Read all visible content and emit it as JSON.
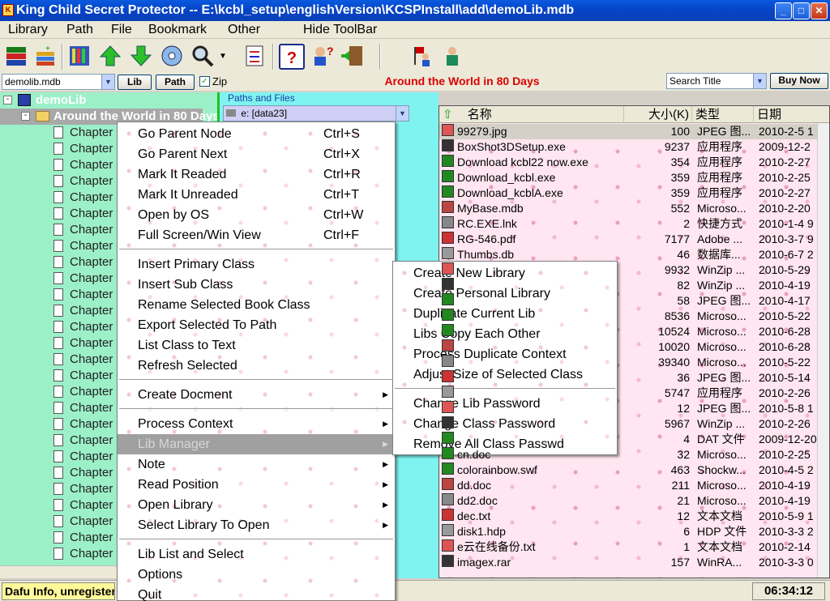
{
  "window": {
    "title": "King Child Secret Protector -- E:\\kcbl_setup\\englishVersion\\KCSPInstall\\add\\demoLib.mdb",
    "icon": "app-icon",
    "buttons": [
      "minimize",
      "maximize",
      "close"
    ]
  },
  "menubar": {
    "items": [
      "Library",
      "Path",
      "File",
      "Bookmark",
      "Other",
      "Hide ToolBar"
    ]
  },
  "toolbar": {
    "icons": [
      "library-books-icon",
      "add-book-icon",
      "bookcase-icon",
      "arrow-up-icon",
      "arrow-down-icon",
      "disc-icon",
      "search-icon",
      "dropdown-arrow-icon",
      "checklist-icon",
      "help-icon",
      "question-person-icon",
      "exit-door-icon",
      "flag-person-icon",
      "person-icon"
    ]
  },
  "addressbar": {
    "library_combo": "demolib.mdb",
    "lib_button": "Lib",
    "path_button": "Path",
    "zip_label": "Zip",
    "zip_checked": true,
    "book_title": "Around the World in 80 Days",
    "search_combo": "Search Title",
    "buy_button": "Buy Now"
  },
  "tree": {
    "root": "demoLib",
    "book": "Around the World in 80 Days",
    "chapter_label": "Chapter",
    "chapter_count": 27
  },
  "paths": {
    "label": "Paths and Files",
    "drive": "e: [data23]"
  },
  "files": {
    "columns": [
      "名称",
      "大小(K)",
      "类型",
      "日期"
    ],
    "rows": [
      {
        "name": "99279.jpg",
        "size": "100",
        "type": "JPEG 图...",
        "date": "2010-2-5 1"
      },
      {
        "name": "BoxShot3DSetup.exe",
        "size": "9237",
        "type": "应用程序",
        "date": "2009-12-2"
      },
      {
        "name": "Download kcbl22 now.exe",
        "size": "354",
        "type": "应用程序",
        "date": "2010-2-27"
      },
      {
        "name": "Download_kcbl.exe",
        "size": "359",
        "type": "应用程序",
        "date": "2010-2-25"
      },
      {
        "name": "Download_kcblA.exe",
        "size": "359",
        "type": "应用程序",
        "date": "2010-2-27"
      },
      {
        "name": "MyBase.mdb",
        "size": "552",
        "type": "Microso...",
        "date": "2010-2-20"
      },
      {
        "name": "RC.EXE.lnk",
        "size": "2",
        "type": "快捷方式",
        "date": "2010-1-4 9"
      },
      {
        "name": "RG-546.pdf",
        "size": "7177",
        "type": "Adobe ...",
        "date": "2010-3-7 9"
      },
      {
        "name": "Thumbs.db",
        "size": "46",
        "type": "数据库...",
        "date": "2010-6-7 2"
      },
      {
        "name": "",
        "size": "9932",
        "type": "WinZip ...",
        "date": "2010-5-29"
      },
      {
        "name": "",
        "size": "82",
        "type": "WinZip ...",
        "date": "2010-4-19"
      },
      {
        "name": "",
        "size": "58",
        "type": "JPEG 图...",
        "date": "2010-4-17"
      },
      {
        "name": "",
        "size": "8536",
        "type": "Microso...",
        "date": "2010-5-22"
      },
      {
        "name": "",
        "size": "10524",
        "type": "Microso...",
        "date": "2010-6-28"
      },
      {
        "name": "",
        "size": "10020",
        "type": "Microso...",
        "date": "2010-6-28"
      },
      {
        "name": "",
        "size": "39340",
        "type": "Microso...",
        "date": "2010-5-22"
      },
      {
        "name": "",
        "size": "36",
        "type": "JPEG 图...",
        "date": "2010-5-14"
      },
      {
        "name": "",
        "size": "5747",
        "type": "应用程序",
        "date": "2010-2-26"
      },
      {
        "name": "",
        "size": "12",
        "type": "JPEG 图...",
        "date": "2010-5-8 1"
      },
      {
        "name": "",
        "size": "5967",
        "type": "WinZip ...",
        "date": "2010-2-26"
      },
      {
        "name": "",
        "size": "4",
        "type": "DAT 文件",
        "date": "2009-12-20"
      },
      {
        "name": "cn.doc",
        "size": "32",
        "type": "Microso...",
        "date": "2010-2-25"
      },
      {
        "name": "colorainbow.swf",
        "size": "463",
        "type": "Shockw...",
        "date": "2010-4-5 2"
      },
      {
        "name": "dd.doc",
        "size": "211",
        "type": "Microso...",
        "date": "2010-4-19"
      },
      {
        "name": "dd2.doc",
        "size": "21",
        "type": "Microso...",
        "date": "2010-4-19"
      },
      {
        "name": "dec.txt",
        "size": "12",
        "type": "文本文档",
        "date": "2010-5-9 1"
      },
      {
        "name": "disk1.hdp",
        "size": "6",
        "type": "HDP 文件",
        "date": "2010-3-3 2"
      },
      {
        "name": "e云在线备份.txt",
        "size": "1",
        "type": "文本文档",
        "date": "2010-2-14"
      },
      {
        "name": "imagex.rar",
        "size": "157",
        "type": "WinRA...",
        "date": "2010-3-3 0"
      }
    ]
  },
  "context_menu": {
    "items": [
      {
        "label": "Go Parent Node",
        "shortcut": "Ctrl+S"
      },
      {
        "label": "Go Parent Next",
        "shortcut": "Ctrl+X"
      },
      {
        "label": "Mark It Readed",
        "shortcut": "Ctrl+R"
      },
      {
        "label": "Mark It Unreaded",
        "shortcut": "Ctrl+T"
      },
      {
        "label": "Open by OS",
        "shortcut": "Ctrl+W"
      },
      {
        "label": "Full Screen/Win View",
        "shortcut": "Ctrl+F"
      },
      {
        "sep": true
      },
      {
        "label": "Insert Primary Class"
      },
      {
        "label": "Insert Sub Class"
      },
      {
        "label": "Rename Selected Book Class"
      },
      {
        "label": "Export Selected To Path"
      },
      {
        "label": "List Class to Text"
      },
      {
        "label": "Refresh Selected"
      },
      {
        "sep": true
      },
      {
        "label": "Create Docment",
        "submenu": true
      },
      {
        "sep": true
      },
      {
        "label": "Process Context",
        "submenu": true
      },
      {
        "label": "Lib Manager",
        "submenu": true,
        "highlighted": true
      },
      {
        "label": "Note",
        "submenu": true
      },
      {
        "label": "Read Position",
        "submenu": true
      },
      {
        "label": "Open Library",
        "submenu": true
      },
      {
        "label": "Select Library To Open",
        "submenu": true
      },
      {
        "sep": true
      },
      {
        "label": "Lib List and Select"
      },
      {
        "label": "Options"
      },
      {
        "label": "Quit"
      }
    ]
  },
  "lib_manager_submenu": {
    "items": [
      {
        "label": "Create New Library"
      },
      {
        "label": "Create Personal Library"
      },
      {
        "label": "Duplicate Current Lib"
      },
      {
        "label": "Libs Copy Each Other"
      },
      {
        "label": "Process Duplicate Context"
      },
      {
        "label": "Adjust Size of Selected Class"
      },
      {
        "sep": true
      },
      {
        "label": "Change Lib Password"
      },
      {
        "label": "Change Class Password"
      },
      {
        "label": "Remove All Class Passwd"
      }
    ]
  },
  "statusbar": {
    "info": "Dafu Info, unregistered",
    "clock": "06:34:12"
  },
  "colors": {
    "tree_bg": "#9cf0c8",
    "paths_bg": "#7ff3f0",
    "files_bg": "#ffe6f0",
    "title_red": "#dd0000",
    "menu_highlight": "#a0a0a0"
  }
}
